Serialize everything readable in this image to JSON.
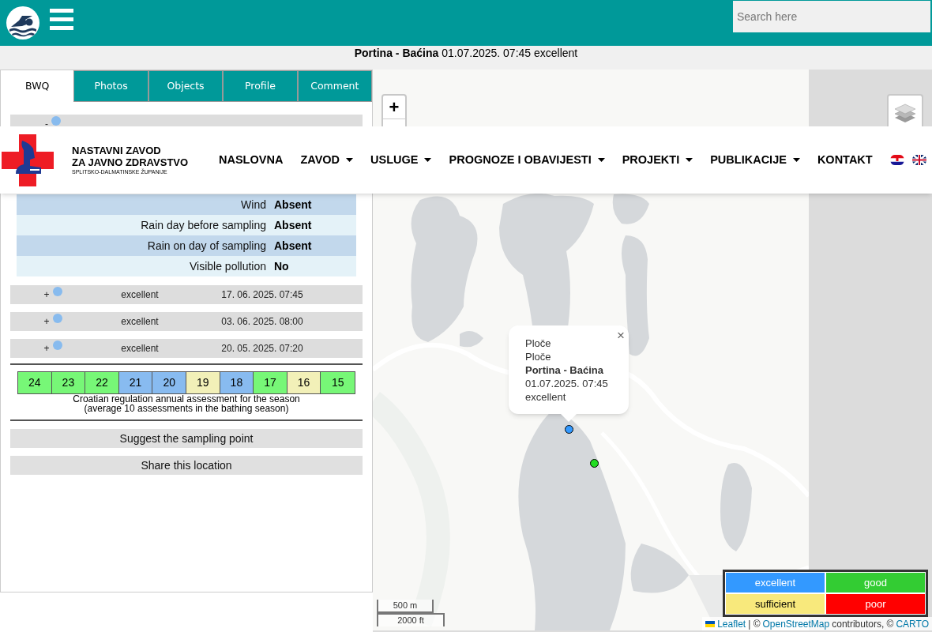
{
  "topbar": {
    "search": {
      "placeholder": "Search here"
    }
  },
  "title": "**Portina - Baćina** 01.07.2025. 07:45 excellent",
  "tabs": [
    {
      "label": "BWQ",
      "selected": true
    },
    {
      "label": "Photos",
      "selected": false
    },
    {
      "label": "Objects",
      "selected": false
    },
    {
      "label": "Profile",
      "selected": false
    },
    {
      "label": "Comment",
      "selected": false
    }
  ],
  "first_sample": {
    "toggle": "-",
    "color": "#88bbee"
  },
  "conditions": [
    {
      "label": "Wind",
      "value": "Absent"
    },
    {
      "label": "Rain day before sampling",
      "value": "Absent"
    },
    {
      "label": "Rain on day of sampling",
      "value": "Absent"
    },
    {
      "label": "Visible pollution",
      "value": "No"
    }
  ],
  "samples": [
    {
      "toggle": "+",
      "color": "#88bbee",
      "quality": "excellent",
      "date": "17. 06. 2025. 07:45"
    },
    {
      "toggle": "+",
      "color": "#88bbee",
      "quality": "excellent",
      "date": "03. 06. 2025. 08:00"
    },
    {
      "toggle": "+",
      "color": "#88bbee",
      "quality": "excellent",
      "date": "20. 05. 2025. 07:20"
    }
  ],
  "assessment": {
    "cells": [
      {
        "value": "24",
        "color": "#77f777"
      },
      {
        "value": "23",
        "color": "#77f777"
      },
      {
        "value": "22",
        "color": "#77f777"
      },
      {
        "value": "21",
        "color": "#88bbf0"
      },
      {
        "value": "20",
        "color": "#88bbf0"
      },
      {
        "value": "19",
        "color": "#f2f0b8"
      },
      {
        "value": "18",
        "color": "#88bbf0"
      },
      {
        "value": "17",
        "color": "#77f777"
      },
      {
        "value": "16",
        "color": "#f2f0b8"
      },
      {
        "value": "15",
        "color": "#77f777"
      }
    ],
    "caption": [
      "Croatian regulation annual assessment for the season",
      "(average 10 assessments in the bathing season)"
    ]
  },
  "actions": [
    "Suggest the sampling point",
    "Share this location"
  ],
  "map": {
    "zoom_in": "+",
    "markers": [
      {
        "color": "#3399ff"
      },
      {
        "color": "#22dd22"
      }
    ],
    "popup": {
      "close": "×",
      "lines": [
        {
          "text": "Ploče",
          "bold": false
        },
        {
          "text": "Ploče",
          "bold": false
        },
        {
          "text": "Portina - Baćina",
          "bold": true
        },
        {
          "text": "01.07.2025. 07:45",
          "bold": false
        },
        {
          "text": "excellent",
          "bold": false
        }
      ]
    },
    "scale": [
      "500 m",
      "2000 ft"
    ],
    "legend": [
      {
        "label": "excellent",
        "color": "#3399ff"
      },
      {
        "label": "good",
        "color": "#33cc33"
      },
      {
        "label": "sufficient",
        "color": "#f8e97c"
      },
      {
        "label": "poor",
        "color": "#ff0000"
      }
    ],
    "attribution": [
      {
        "text": "Leaflet",
        "link": true
      },
      {
        "text": "| ©",
        "link": false
      },
      {
        "text": "OpenStreetMap",
        "link": true
      },
      {
        "text": "contributors, ©",
        "link": false
      },
      {
        "text": "CARTO",
        "link": true
      }
    ]
  },
  "nav": {
    "org": [
      "NASTAVNI ZAVOD",
      "ZA JAVNO ZDRAVSTVO",
      "SPLITSKO-DALMATINSKE ŽUPANIJE"
    ],
    "items": [
      {
        "label": "NASLOVNA",
        "dropdown": false
      },
      {
        "label": "ZAVOD",
        "dropdown": true
      },
      {
        "label": "USLUGE",
        "dropdown": true
      },
      {
        "label": "PROGNOZE I OBAVIJESTI",
        "dropdown": true
      },
      {
        "label": "PROJEKTI",
        "dropdown": true
      },
      {
        "label": "PUBLIKACIJE",
        "dropdown": true
      },
      {
        "label": "KONTAKT",
        "dropdown": false
      }
    ]
  }
}
